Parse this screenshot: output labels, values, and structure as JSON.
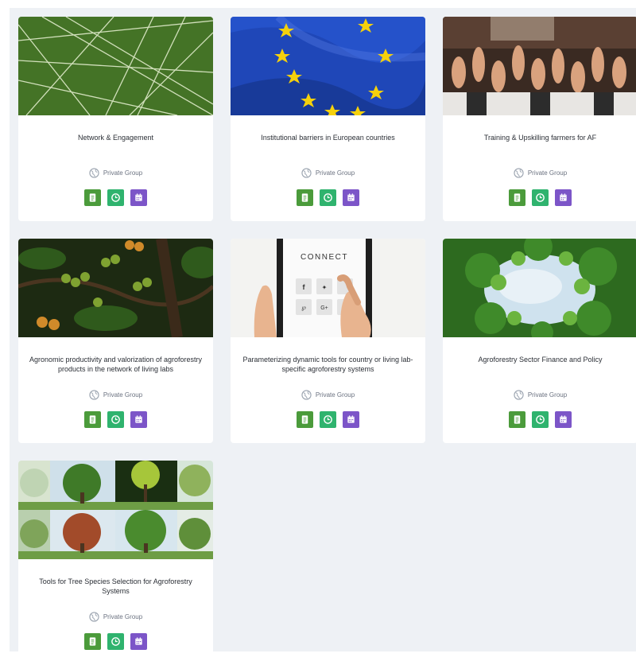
{
  "groups": [
    {
      "title": "Network & Engagement",
      "privacy": "Private Group",
      "image": "network-lines-image"
    },
    {
      "title": "Institutional barriers in European countries",
      "privacy": "Private Group",
      "image": "eu-flag-image"
    },
    {
      "title": "Training & Upskilling farmers for AF",
      "privacy": "Private Group",
      "image": "raised-hands-image"
    },
    {
      "title": "Agronomic productivity and valorization of agroforestry products in the network of living labs",
      "privacy": "Private Group",
      "image": "coffee-cherries-image"
    },
    {
      "title": "Parameterizing dynamic tools for country or living lab-specific agroforestry systems",
      "privacy": "Private Group",
      "image": "connect-tablet-image"
    },
    {
      "title": "Agroforestry Sector Finance and Policy",
      "privacy": "Private Group",
      "image": "tree-canopy-sky-image"
    },
    {
      "title": "Tools for Tree Species Selection for Agroforestry Systems",
      "privacy": "Private Group",
      "image": "tree-species-grid-image"
    }
  ],
  "tablet": {
    "connect": "CONNECT",
    "gplus": "G+"
  },
  "icons": {
    "privacy": "globe-icon",
    "buttons": [
      "document-icon",
      "clock-icon",
      "calendar-icon"
    ]
  },
  "colors": {
    "page_bg": "#eef1f5",
    "card_bg": "#ffffff",
    "btn_document": "#4b9b3b",
    "btn_clock": "#2fb36e",
    "btn_calendar": "#7c55c8",
    "eu_blue": "#1f47b8",
    "eu_star": "#f5d10c"
  }
}
